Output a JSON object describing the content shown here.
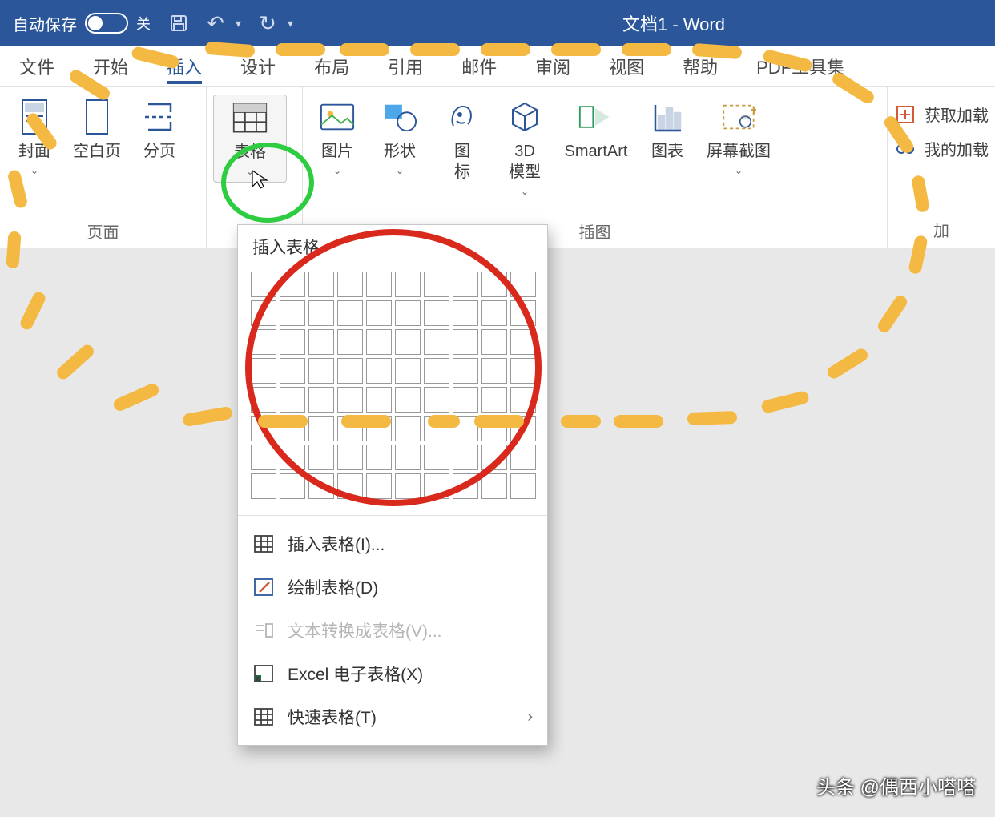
{
  "titlebar": {
    "autosave_label": "自动保存",
    "autosave_state": "关",
    "document_title": "文档1  -  Word"
  },
  "tabs": [
    "文件",
    "开始",
    "插入",
    "设计",
    "布局",
    "引用",
    "邮件",
    "审阅",
    "视图",
    "帮助",
    "PDF工具集"
  ],
  "active_tab_index": 2,
  "ribbon": {
    "groups": [
      {
        "label": "页面",
        "items": [
          {
            "label": "封面",
            "dropdown": true,
            "icon": "cover-page-icon"
          },
          {
            "label": "空白页",
            "dropdown": false,
            "icon": "blank-page-icon"
          },
          {
            "label": "分页",
            "dropdown": false,
            "icon": "page-break-icon"
          }
        ]
      },
      {
        "label": "",
        "items": [
          {
            "label": "表格",
            "dropdown": true,
            "icon": "table-icon",
            "highlight": true
          }
        ]
      },
      {
        "label": "插图",
        "items": [
          {
            "label": "图片",
            "dropdown": true,
            "icon": "picture-icon"
          },
          {
            "label": "形状",
            "dropdown": true,
            "icon": "shapes-icon"
          },
          {
            "label": "图\n标",
            "dropdown": false,
            "icon": "icons-icon"
          },
          {
            "label": "3D\n模型",
            "dropdown": true,
            "icon": "3d-model-icon"
          },
          {
            "label": "SmartArt",
            "dropdown": false,
            "icon": "smartart-icon"
          },
          {
            "label": "图表",
            "dropdown": false,
            "icon": "chart-icon"
          },
          {
            "label": "屏幕截图",
            "dropdown": true,
            "icon": "screenshot-icon"
          }
        ]
      }
    ],
    "side": [
      {
        "label": "获取加载",
        "icon": "addins-get-icon"
      },
      {
        "label": "我的加载",
        "icon": "addins-my-icon"
      }
    ],
    "side_label": "加"
  },
  "dropdown": {
    "title": "插入表格",
    "grid_cols": 10,
    "grid_rows": 8,
    "menu": [
      {
        "label": "插入表格(I)...",
        "icon": "insert-table-icon",
        "disabled": false
      },
      {
        "label": "绘制表格(D)",
        "icon": "draw-table-icon",
        "disabled": false
      },
      {
        "label": "文本转换成表格(V)...",
        "icon": "text-to-table-icon",
        "disabled": true
      },
      {
        "label": "Excel 电子表格(X)",
        "icon": "excel-sheet-icon",
        "disabled": false
      },
      {
        "label": "快速表格(T)",
        "icon": "quick-tables-icon",
        "disabled": false,
        "submenu": true
      }
    ]
  },
  "watermark": "头条 @偶西小嗒嗒"
}
